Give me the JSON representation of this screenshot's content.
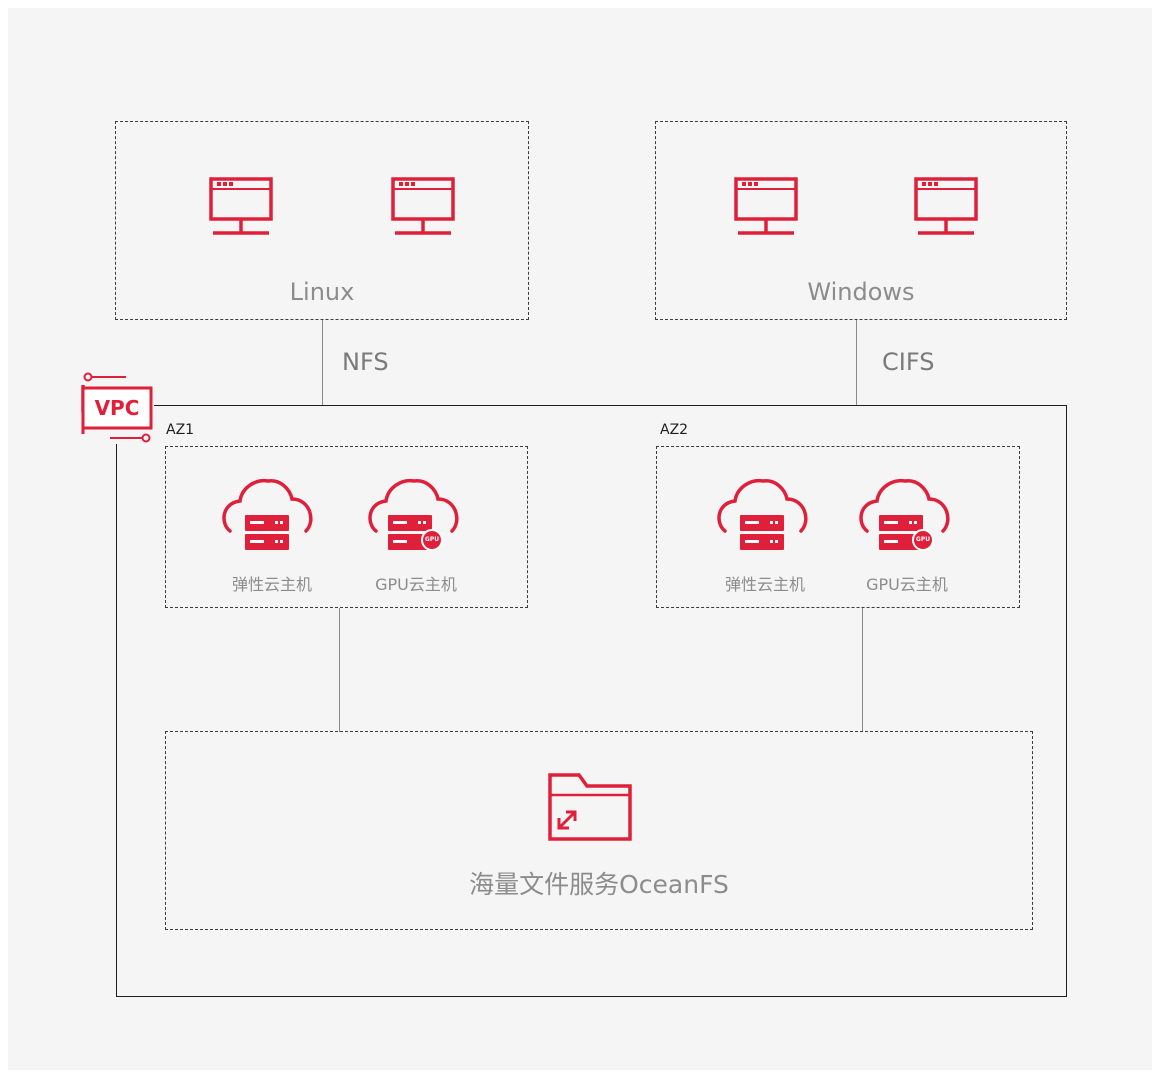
{
  "clients": {
    "linux_label": "Linux",
    "windows_label": "Windows"
  },
  "protocols": {
    "nfs": "NFS",
    "cifs": "CIFS"
  },
  "vpc": {
    "badge": "VPC"
  },
  "zones": [
    {
      "label": "AZ1",
      "ecs_label": "弹性云主机",
      "gpu_label": "GPU云主机",
      "gpu_badge": "GPU"
    },
    {
      "label": "AZ2",
      "ecs_label": "弹性云主机",
      "gpu_label": "GPU云主机",
      "gpu_badge": "GPU"
    }
  ],
  "storage": {
    "label": "海量文件服务OceanFS"
  },
  "colors": {
    "accent": "#e0203a",
    "text_gray": "#8c8c8c",
    "background": "#f5f5f5"
  },
  "icons": [
    "monitor-icon",
    "vpc-icon",
    "cloud-server-icon",
    "cloud-gpu-server-icon",
    "folder-icon"
  ]
}
